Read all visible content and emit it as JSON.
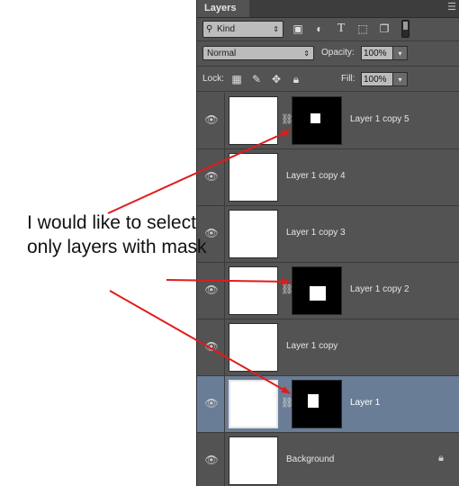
{
  "panel": {
    "tab_label": "Layers",
    "menu_icon": "panel-menu-icon",
    "filter": {
      "kind_label": "Kind",
      "icons": [
        "image-filter-icon",
        "adjustment-filter-icon",
        "type-filter-icon",
        "shape-filter-icon",
        "smart-object-filter-icon"
      ]
    },
    "blend_mode": "Normal",
    "opacity_label": "Opacity:",
    "opacity_value": "100%",
    "lock_label": "Lock:",
    "fill_label": "Fill:",
    "fill_value": "100%",
    "layers": [
      {
        "name": "Layer 1 copy 5",
        "has_mask": true,
        "selected": false
      },
      {
        "name": "Layer 1 copy 4",
        "has_mask": false,
        "selected": false
      },
      {
        "name": "Layer 1 copy 3",
        "has_mask": false,
        "selected": false
      },
      {
        "name": "Layer 1 copy 2",
        "has_mask": true,
        "selected": false
      },
      {
        "name": "Layer 1 copy",
        "has_mask": false,
        "selected": false
      },
      {
        "name": "Layer 1",
        "has_mask": true,
        "selected": true
      },
      {
        "name": "Background",
        "has_mask": false,
        "selected": false,
        "locked": true
      }
    ]
  },
  "annotation": {
    "text": "I would like to select only layers with mask",
    "arrow_color": "#e01b1b"
  },
  "colors": {
    "panel_bg": "#535353",
    "selected_row": "#6a7d97",
    "arrow": "#e01b1b"
  }
}
